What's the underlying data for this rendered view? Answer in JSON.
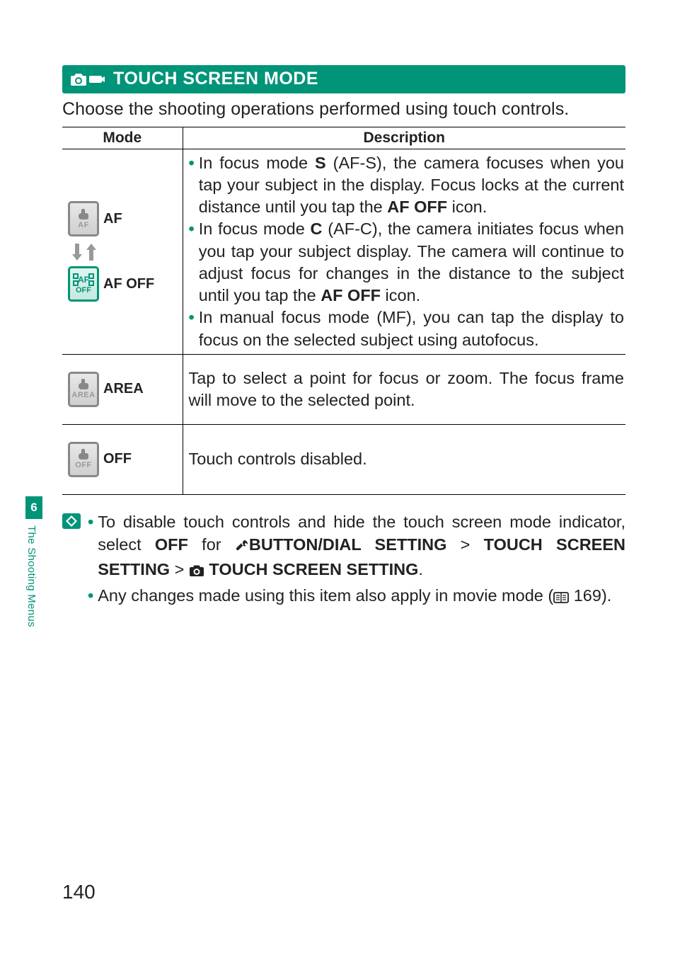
{
  "heading": "TOUCH SCREEN MODE",
  "intro": "Choose the shooting operations performed using touch controls.",
  "table": {
    "headers": {
      "mode": "Mode",
      "description": "Description"
    },
    "rows": [
      {
        "modes": [
          {
            "label": "AF",
            "icon_sub": "AF",
            "icon_name": "touch-af-icon"
          },
          {
            "label": "AF OFF",
            "icon_sub": "OFF",
            "icon_name": "touch-afoff-icon"
          }
        ],
        "items": [
          {
            "pre": "In focus mode ",
            "bold1": "S",
            "mid": " (AF-S), the camera focuses when you tap your subject in the display. Focus locks at the current distance until you tap the ",
            "bold2": "AF OFF",
            "post": " icon."
          },
          {
            "pre": "In focus mode ",
            "bold1": "C",
            "mid": " (AF-C), the camera initiates focus when you tap your subject display. The camera will continue to adjust focus for changes in the distance to the subject until you tap the ",
            "bold2": "AF OFF",
            "post": " icon."
          },
          {
            "pre": "In manual focus mode (MF), you can tap the display to focus on the selected subject using autofocus.",
            "bold1": "",
            "mid": "",
            "bold2": "",
            "post": ""
          }
        ]
      },
      {
        "modes": [
          {
            "label": "AREA",
            "icon_sub": "AREA",
            "icon_name": "touch-area-icon"
          }
        ],
        "desc": "Tap to select a point for focus or zoom. The focus frame will move to the selected point."
      },
      {
        "modes": [
          {
            "label": "OFF",
            "icon_sub": "OFF",
            "icon_name": "touch-off-icon"
          }
        ],
        "desc": "Touch controls disabled."
      }
    ]
  },
  "notes": {
    "items": [
      {
        "t1": "To disable touch controls and hide the touch screen mode indicator, select ",
        "b1": "OFF",
        "t2": " for ",
        "b2": "BUTTON/DIAL SETTING",
        "t3": " > ",
        "b3": "TOUCH SCREEN SETTING",
        "t4": " > ",
        "b4": " TOUCH SCREEN SETTING",
        "t5": "."
      },
      {
        "t1": "Any changes made using this item also apply in movie mode (",
        "ref": " 169).",
        "icon": "book"
      }
    ]
  },
  "side": {
    "chapter": "6",
    "label": "The Shooting Menus"
  },
  "page_number": "140"
}
